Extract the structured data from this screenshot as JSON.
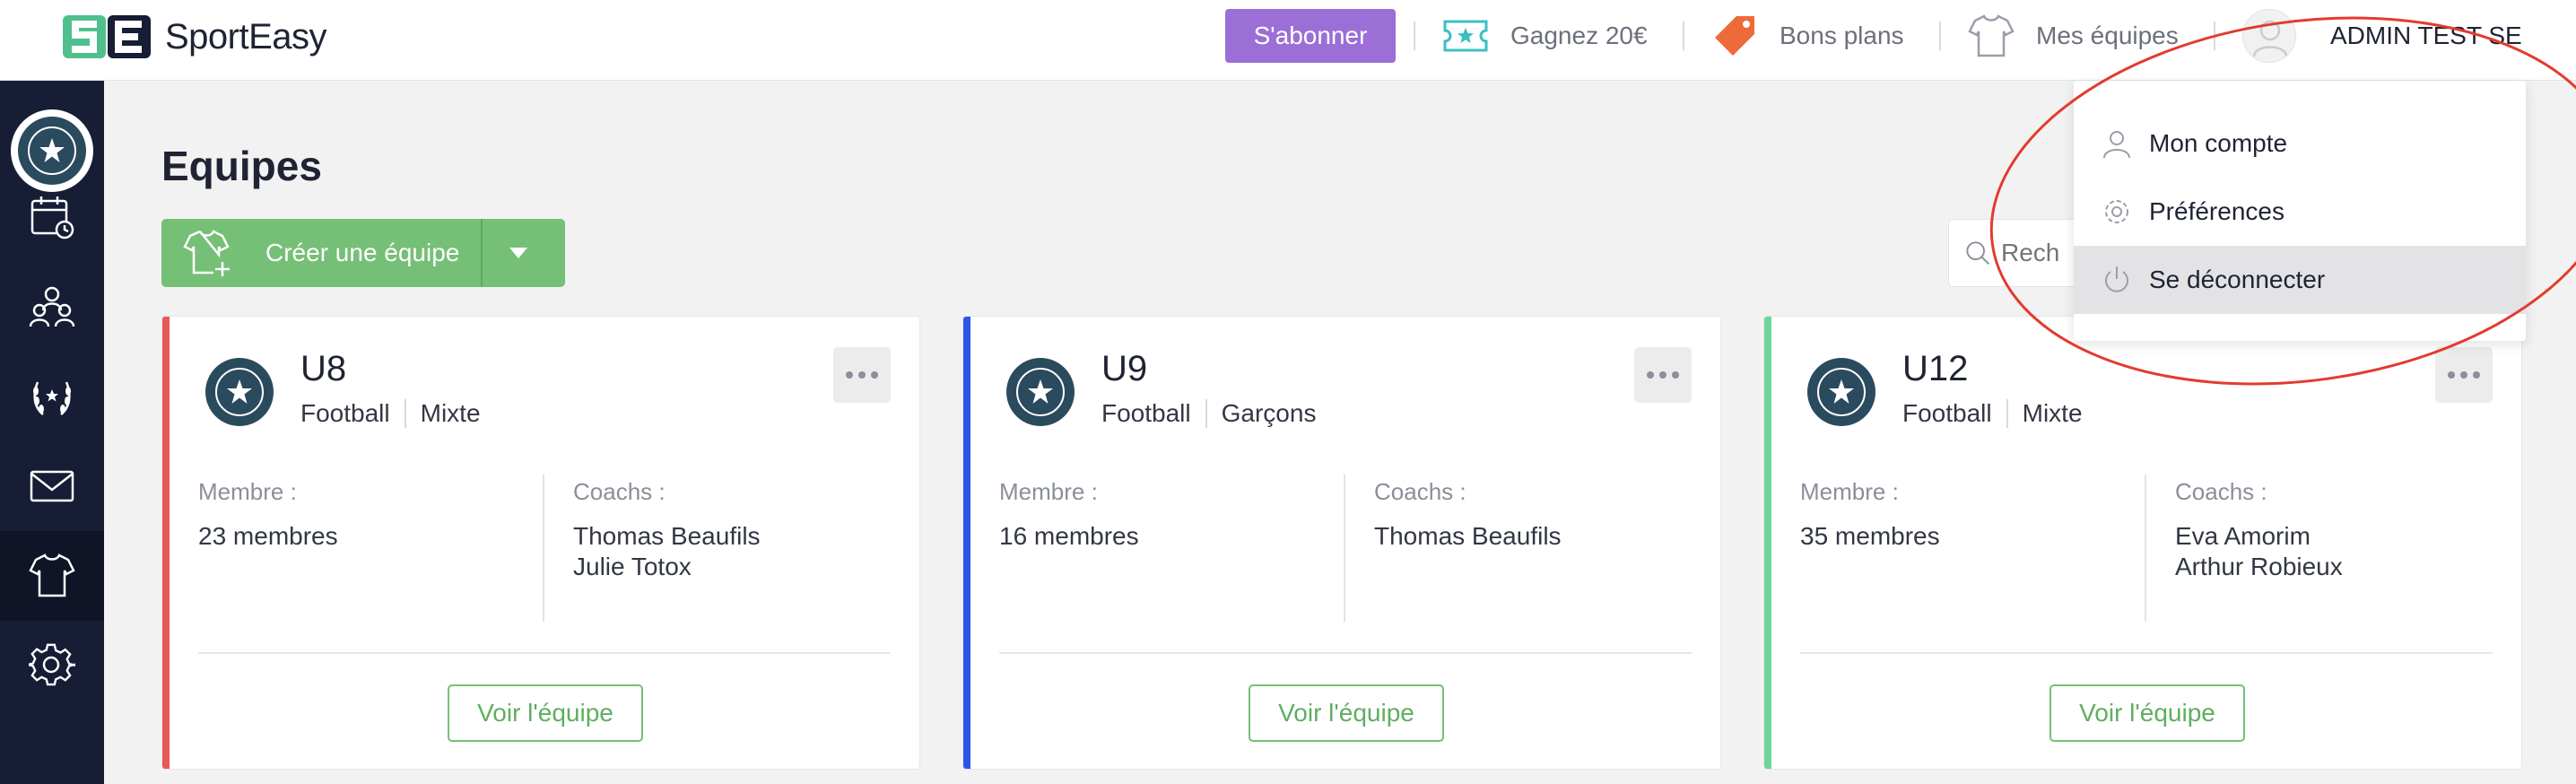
{
  "header": {
    "brand": "SportEasy",
    "subscribe_label": "S'abonner",
    "referral_label": "Gagnez 20€",
    "deals_label": "Bons plans",
    "teams_label": "Mes équipes",
    "user_name": "ADMIN TEST SE",
    "colors": {
      "subscribe": "#9b6fd6",
      "referral_icon": "#3cbfc0",
      "deals_icon": "#ef6a3a"
    }
  },
  "sidebar": {
    "items": [
      {
        "icon": "calendar-icon"
      },
      {
        "icon": "members-icon"
      },
      {
        "icon": "laurel-icon"
      },
      {
        "icon": "mail-icon"
      },
      {
        "icon": "jersey-icon",
        "active": true
      },
      {
        "icon": "gear-icon"
      }
    ]
  },
  "main": {
    "title": "Equipes",
    "create_label": "Créer une équipe",
    "search_placeholder": "Rech"
  },
  "user_menu": {
    "items": [
      {
        "label": "Mon compte",
        "icon": "user-icon"
      },
      {
        "label": "Préférences",
        "icon": "gear-icon"
      },
      {
        "label": "Se déconnecter",
        "icon": "power-icon",
        "highlighted": true
      }
    ]
  },
  "teams": [
    {
      "name": "U8",
      "sport": "Football",
      "gender": "Mixte",
      "members_label": "Membre :",
      "members": "23 membres",
      "coaches_label": "Coachs :",
      "coaches": [
        "Thomas Beaufils",
        "Julie Totox"
      ],
      "button": "Voir l'équipe",
      "color": "#e9585a"
    },
    {
      "name": "U9",
      "sport": "Football",
      "gender": "Garçons",
      "members_label": "Membre :",
      "members": "16 membres",
      "coaches_label": "Coachs :",
      "coaches": [
        "Thomas Beaufils"
      ],
      "button": "Voir l'équipe",
      "color": "#2a57e6"
    },
    {
      "name": "U12",
      "sport": "Football",
      "gender": "Mixte",
      "members_label": "Membre :",
      "members": "35 membres",
      "coaches_label": "Coachs :",
      "coaches": [
        "Eva Amorim",
        "Arthur Robieux"
      ],
      "button": "Voir l'équipe",
      "color": "#6fd49b"
    }
  ]
}
